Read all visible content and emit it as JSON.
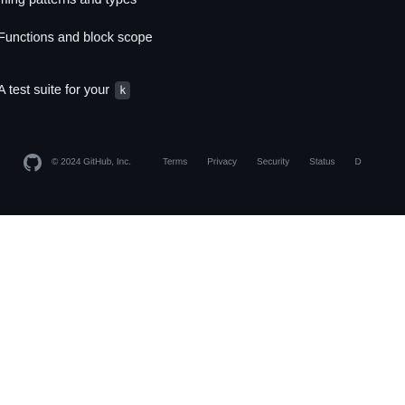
{
  "content": {
    "line1": "Naming patterns and types",
    "line2": "Functions and block scope",
    "line3": "A test suite for your",
    "line3_code": "k"
  },
  "footer": {
    "logo_icon": "github-mark-icon",
    "copyright": "© 2024 GitHub, Inc.",
    "links": [
      "Terms",
      "Privacy",
      "Security",
      "Status",
      "D"
    ]
  },
  "colors": {
    "dark_bg": "#0d1117",
    "text": "#e6edf3",
    "muted": "#7d8590",
    "code_bg": "#343942",
    "light_bg": "#ffffff"
  }
}
